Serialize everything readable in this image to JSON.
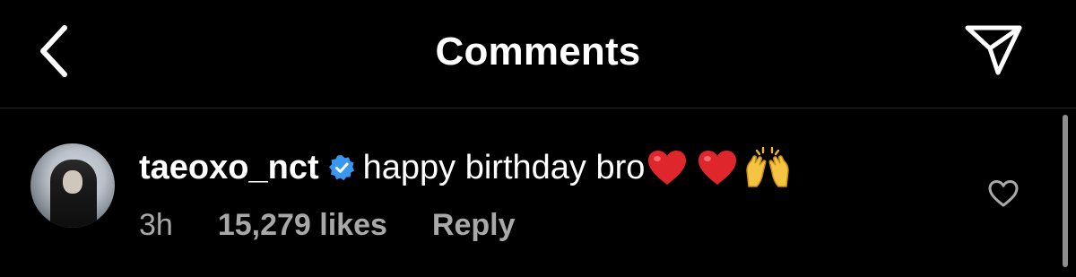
{
  "header": {
    "title": "Comments",
    "back_icon": "chevron-left-icon",
    "share_icon": "paper-plane-icon"
  },
  "comment": {
    "username": "taeoxo_nct",
    "verified_icon": "verified-badge-icon",
    "text": "happy birthday bro",
    "emojis": [
      "red-heart-emoji",
      "red-heart-emoji",
      "raising-hands-emoji"
    ],
    "time": "3h",
    "likes": "15,279 likes",
    "reply": "Reply",
    "like_icon": "heart-outline-icon"
  },
  "colors": {
    "background": "#000000",
    "text": "#ffffff",
    "secondary_text": "#a8a8a8",
    "verified_blue": "#3897f0",
    "heart_red": "#e0262d"
  }
}
